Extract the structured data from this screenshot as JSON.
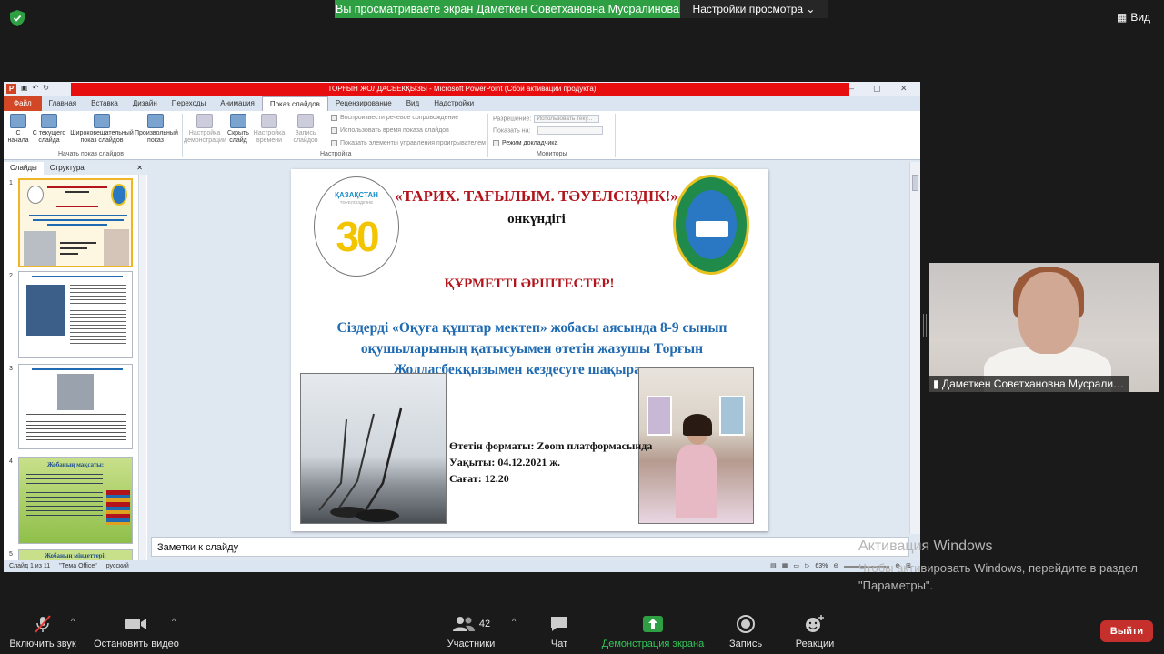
{
  "zoom": {
    "share_banner": "Вы просматриваете экран Даметкен Советхановна Мусралинова",
    "view_settings": "Настройки просмотра",
    "view_btn": "Вид",
    "participant_name": "Даметкен Советхановна Мусрали…",
    "participants_count": "42",
    "toolbar": {
      "mute": "Включить звук",
      "video": "Остановить видео",
      "participants": "Участники",
      "chat": "Чат",
      "share": "Демонстрация экрана",
      "record": "Запись",
      "reactions": "Реакции",
      "leave": "Выйти"
    }
  },
  "ppt": {
    "title": "ТОРҒЫН ЖОЛДАСБЕКҚЫЗЫ - Microsoft PowerPoint (Сбой активации продукта)",
    "tabs": [
      "Файл",
      "Главная",
      "Вставка",
      "Дизайн",
      "Переходы",
      "Анимация",
      "Показ слайдов",
      "Рецензирование",
      "Вид",
      "Надстройки"
    ],
    "ribbon": {
      "from_start": "С начала",
      "from_current": "С текущего слайда",
      "broadcast": "Широковещательный показ слайдов",
      "custom": "Произвольный показ",
      "group_start": "Начать показ слайдов",
      "setup": "Настройка демонстрации",
      "hide": "Скрыть слайд",
      "rehearse": "Настройка времени",
      "record": "Запись слайдов",
      "chk_narration": "Воспроизвести речевое сопровождение",
      "chk_timings": "Использовать время показа слайдов",
      "chk_controls": "Показать элементы управления проигрывателем",
      "group_setup": "Настройка",
      "resolution_label": "Разрешение:",
      "resolution_value": "Использовать теку...",
      "show_on_label": "Показать на:",
      "presenter_view": "Режим докладчика",
      "group_monitors": "Мониторы"
    },
    "pane_tabs": [
      "Слайды",
      "Структура"
    ],
    "thumb_nums": [
      "1",
      "2",
      "3",
      "4",
      "5"
    ],
    "thumb4_title": "Жобаның мақсаты:",
    "thumb5_title": "Жобаның міндеттері:",
    "notes_placeholder": "Заметки к слайду",
    "status": {
      "slide": "Слайд 1 из 11",
      "theme": "\"Тема Office\"",
      "lang": "русский",
      "zoom": "63%"
    }
  },
  "slide": {
    "title": "«ТАРИХ. ТАҒЫЛЫМ. ТӘУЕЛСІЗДІК!»",
    "subtitle": "онкүндігі",
    "greeting": "ҚҰРМЕТТІ ӘРІПТЕСТЕР!",
    "body": "Сіздерді «Оқуға құштар мектеп» жобасы аясында 8-9 сынып оқушыларының қатысуымен өтетін жазушы Торғын Жолдасбекқызымен кездесуге шақырамыз.",
    "format": "Өтетін форматы: Zoom платформасында",
    "date": "Уақыты: 04.12.2021 ж.",
    "time": "Сағат: 12.20",
    "logo_text_1": "ҚАЗАҚСТАН",
    "logo_text_2": "ТӘУЕЛСІЗДІГІНЕ",
    "logo_number": "30"
  },
  "windows_activation": {
    "title": "Активация Windows",
    "text": "Чтобы активировать Windows, перейдите в раздел \"Параметры\"."
  },
  "colors": {
    "share_green": "#2ea043",
    "leave_red": "#c6302c",
    "slide_red": "#b3141b",
    "slide_blue": "#1f6ab0"
  }
}
